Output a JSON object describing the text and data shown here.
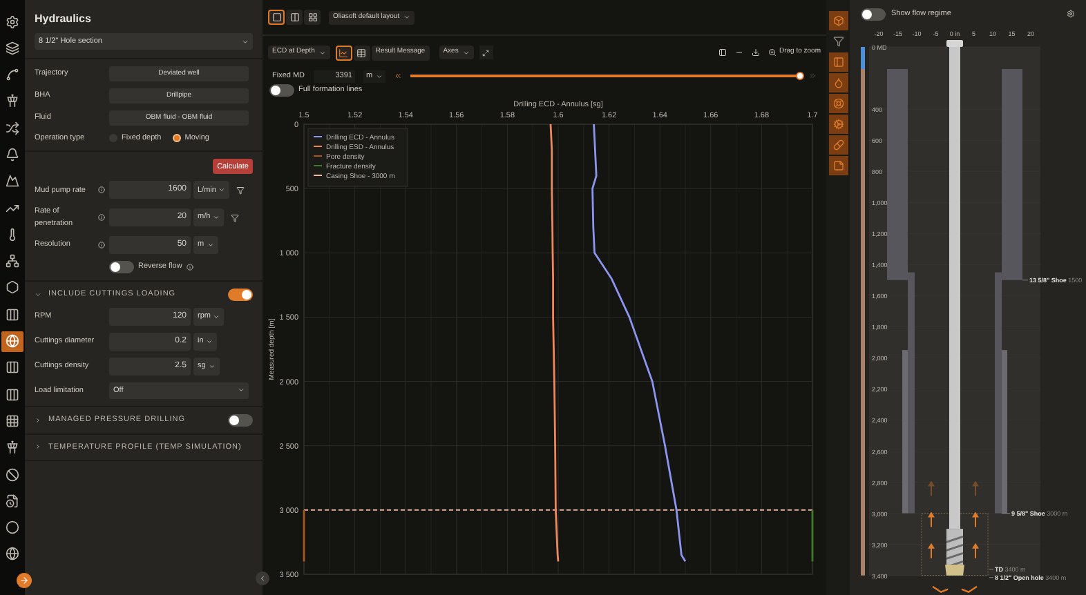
{
  "rail": {
    "items": [
      {
        "kind": "gear",
        "selected": false
      },
      {
        "kind": "layers",
        "selected": false
      },
      {
        "kind": "curve",
        "selected": false
      },
      {
        "kind": "tower",
        "selected": false
      },
      {
        "kind": "cross",
        "selected": false
      },
      {
        "kind": "bell",
        "selected": false
      },
      {
        "kind": "mountain",
        "selected": false
      },
      {
        "kind": "trend",
        "selected": false
      },
      {
        "kind": "thermometer",
        "selected": false
      },
      {
        "kind": "network",
        "selected": false
      },
      {
        "kind": "hexagon",
        "selected": false
      },
      {
        "kind": "columns",
        "selected": false
      },
      {
        "kind": "globe",
        "selected": true
      },
      {
        "kind": "columns",
        "selected": false
      },
      {
        "kind": "columns",
        "selected": false
      },
      {
        "kind": "grid",
        "selected": false
      },
      {
        "kind": "tower",
        "selected": false
      },
      {
        "kind": "ban",
        "selected": false
      },
      {
        "kind": "file",
        "selected": false
      },
      {
        "kind": "circle",
        "selected": false
      },
      {
        "kind": "globe",
        "selected": false
      }
    ]
  },
  "panel": {
    "title": "Hydraulics",
    "section_select": "8 1/2\" Hole section",
    "selects": [
      {
        "label": "Trajectory",
        "value": "Deviated well"
      },
      {
        "label": "BHA",
        "value": "Drillpipe"
      },
      {
        "label": "Fluid",
        "value": "OBM fluid - OBM fluid"
      }
    ],
    "operation_type": {
      "label": "Operation type",
      "options": [
        {
          "label": "Fixed depth",
          "selected": false
        },
        {
          "label": "Moving",
          "selected": true
        }
      ]
    },
    "calculate": "Calculate",
    "inputs": [
      {
        "label": "Mud pump rate",
        "info": true,
        "value": "1600",
        "unit": "L/min",
        "filter": true
      },
      {
        "label": "Rate of penetration",
        "info": true,
        "value": "20",
        "unit": "m/h",
        "filter": true
      },
      {
        "label": "Resolution",
        "info": true,
        "value": "50",
        "unit": "m",
        "filter": false
      }
    ],
    "reverse_flow": {
      "label": "Reverse flow",
      "on": false
    },
    "sections": [
      {
        "title": "INCLUDE CUTTINGS LOADING",
        "expanded": true,
        "on": true,
        "has_toggle": true,
        "inputs": [
          {
            "label": "RPM",
            "value": "120",
            "unit": "rpm"
          },
          {
            "label": "Cuttings diameter",
            "value": "0.2",
            "unit": "in"
          },
          {
            "label": "Cuttings density",
            "value": "2.5",
            "unit": "sg"
          }
        ],
        "select": {
          "label": "Load limitation",
          "value": "Off"
        }
      },
      {
        "title": "MANAGED PRESSURE DRILLING",
        "expanded": false,
        "on": false,
        "has_toggle": true
      },
      {
        "title": "TEMPERATURE PROFILE (TEMP SIMULATION)",
        "expanded": false,
        "has_toggle": false
      }
    ]
  },
  "toolbar": {
    "layouts": [
      {
        "kind": "single",
        "selected": true
      },
      {
        "kind": "split",
        "selected": false
      },
      {
        "kind": "grid",
        "selected": false
      }
    ],
    "layout_select": "Oliasoft default layout",
    "result_select": "ECD at Depth",
    "view_buttons": [
      {
        "kind": "chart",
        "selected": true
      },
      {
        "kind": "table",
        "selected": false
      }
    ],
    "result_message": "Result Message",
    "axes": "Axes",
    "drag_to_zoom": "Drag to zoom",
    "fixed_md": {
      "label": "Fixed MD",
      "value": "3391",
      "unit": "m",
      "level": 1.0
    },
    "full_formation_lines": {
      "label": "Full formation lines",
      "on": false
    }
  },
  "chart_data": {
    "type": "line",
    "orientation": "horizontal",
    "title": "Drilling ECD - Annulus [sg]",
    "ylabel": "Measured depth [m]",
    "x": [
      0,
      200,
      400,
      500,
      800,
      1000,
      1200,
      1500,
      2000,
      2500,
      3000,
      3350,
      3400
    ],
    "series": [
      {
        "name": "Drilling ECD - Annulus",
        "color": "#8d95f0",
        "values": [
          1.614,
          1.6145,
          1.615,
          1.6135,
          1.6138,
          1.6143,
          1.621,
          1.628,
          1.637,
          1.642,
          1.6465,
          1.6485,
          1.65
        ]
      },
      {
        "name": "Drilling ESD - Annulus",
        "color": "#f0875a",
        "values": [
          1.597,
          1.5975,
          1.5975,
          1.5975,
          1.5977,
          1.5978,
          1.598,
          1.598,
          1.5985,
          1.5988,
          1.599,
          1.5998,
          1.6
        ]
      },
      {
        "name": "Pore density",
        "color": "#a8581e",
        "values": [
          null,
          null,
          null,
          null,
          null,
          null,
          null,
          null,
          null,
          null,
          1.5,
          1.5,
          1.5
        ]
      },
      {
        "name": "Fracture density",
        "color": "#3f7a2a",
        "values": [
          null,
          null,
          null,
          null,
          null,
          null,
          null,
          null,
          null,
          null,
          1.7,
          1.7,
          1.7
        ]
      }
    ],
    "xlim": [
      1.5,
      1.7
    ],
    "ylim": [
      3500,
      0
    ],
    "xticks": [
      {
        "value": 1.5,
        "label": "1.5"
      },
      {
        "value": 1.52,
        "label": "1.52"
      },
      {
        "value": 1.54,
        "label": "1.54"
      },
      {
        "value": 1.56,
        "label": "1.56"
      },
      {
        "value": 1.58,
        "label": "1.58"
      },
      {
        "value": 1.6,
        "label": "1.6"
      },
      {
        "value": 1.62,
        "label": "1.62"
      },
      {
        "value": 1.64,
        "label": "1.64"
      },
      {
        "value": 1.66,
        "label": "1.66"
      },
      {
        "value": 1.68,
        "label": "1.68"
      },
      {
        "value": 1.7,
        "label": "1.7"
      }
    ],
    "yticks": [
      {
        "value": 0,
        "label": "0"
      },
      {
        "value": 500,
        "label": "500"
      },
      {
        "value": 1000,
        "label": "1 000"
      },
      {
        "value": 1500,
        "label": "1 500"
      },
      {
        "value": 2000,
        "label": "2 000"
      },
      {
        "value": 2500,
        "label": "2 500"
      },
      {
        "value": 3000,
        "label": "3 000"
      },
      {
        "value": 3500,
        "label": "3 500"
      }
    ],
    "grid": true,
    "legend": true,
    "ref_lines": [
      {
        "axis": "y",
        "value": 3000,
        "label": "Casing Shoe - 3000 m",
        "color": "#f2b8a0"
      }
    ]
  },
  "tools": [
    {
      "kind": "box",
      "active": true
    },
    {
      "kind": "funnel",
      "active": false
    },
    {
      "kind": "bha",
      "active": true
    },
    {
      "kind": "drop",
      "active": true
    },
    {
      "kind": "wheel",
      "active": true
    },
    {
      "kind": "gear",
      "active": true
    },
    {
      "kind": "pill",
      "active": true
    },
    {
      "kind": "note",
      "active": true
    }
  ],
  "schematic": {
    "flow_regime": {
      "label": "Show flow regime",
      "on": false
    },
    "xticks": [
      "-20",
      "-15",
      "-10",
      "-5",
      "0 in",
      "5",
      "10",
      "15",
      "20"
    ],
    "depth_labels": [
      "0 MD",
      "400",
      "600",
      "800",
      "1,000",
      "1,200",
      "1,400",
      "1,600",
      "1,800",
      "2,000",
      "2,200",
      "2,400",
      "2,600",
      "2,800",
      "3,000",
      "3,200",
      "3,400"
    ],
    "markers": [
      {
        "kind": "shoe",
        "name": "13 5/8\" Shoe",
        "value": "1500"
      },
      {
        "kind": "shoe",
        "name": "9 5/8\" Shoe",
        "value": "3000 m"
      },
      {
        "kind": "td",
        "name": "TD",
        "value": "3400 m"
      },
      {
        "kind": "hole",
        "name": "8 1/2\" Open hole",
        "value": "3400 m"
      }
    ]
  }
}
